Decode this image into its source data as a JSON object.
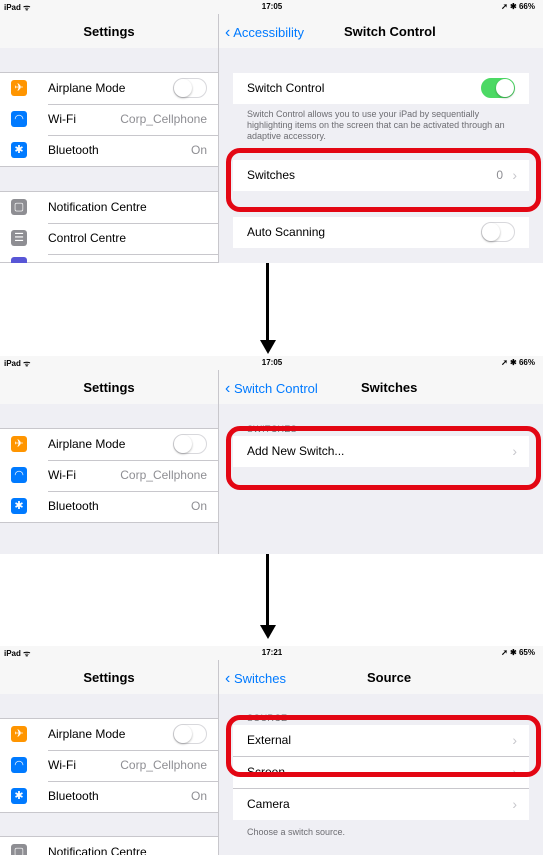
{
  "panels": [
    {
      "status": {
        "carrier": "iPad ᯤ",
        "time": "17:05",
        "battery": "➚ ✱ 66%"
      },
      "left_title": "Settings",
      "back_label": "Accessibility",
      "right_title": "Switch Control",
      "left_items": [
        {
          "label": "Airplane Mode",
          "value": "",
          "icon": "airplane-icon"
        },
        {
          "label": "Wi-Fi",
          "value": "Corp_Cellphone",
          "icon": "wifi-icon"
        },
        {
          "label": "Bluetooth",
          "value": "On",
          "icon": "bluetooth-icon"
        },
        {
          "label": "Notification Centre",
          "value": "",
          "icon": "notification-centre-icon"
        },
        {
          "label": "Control Centre",
          "value": "",
          "icon": "control-centre-icon"
        }
      ],
      "switch_control_label": "Switch Control",
      "switch_control_note": "Switch Control allows you to use your iPad by sequentially highlighting items on the screen that can be activated through an adaptive accessory.",
      "switches_label": "Switches",
      "switches_value": "0",
      "auto_scanning_label": "Auto Scanning"
    },
    {
      "status": {
        "carrier": "iPad ᯤ",
        "time": "17:05",
        "battery": "➚ ✱ 66%"
      },
      "left_title": "Settings",
      "back_label": "Switch Control",
      "right_title": "Switches",
      "left_items": [
        {
          "label": "Airplane Mode",
          "value": "",
          "icon": "airplane-icon"
        },
        {
          "label": "Wi-Fi",
          "value": "Corp_Cellphone",
          "icon": "wifi-icon"
        },
        {
          "label": "Bluetooth",
          "value": "On",
          "icon": "bluetooth-icon"
        }
      ],
      "section_header": "SWITCHES",
      "add_switch_label": "Add New Switch..."
    },
    {
      "status": {
        "carrier": "iPad ᯤ",
        "time": "17:21",
        "battery": "➚ ✱ 65%"
      },
      "left_title": "Settings",
      "back_label": "Switches",
      "right_title": "Source",
      "left_items": [
        {
          "label": "Airplane Mode",
          "value": "",
          "icon": "airplane-icon"
        },
        {
          "label": "Wi-Fi",
          "value": "Corp_Cellphone",
          "icon": "wifi-icon"
        },
        {
          "label": "Bluetooth",
          "value": "On",
          "icon": "bluetooth-icon"
        },
        {
          "label": "Notification Centre",
          "value": "",
          "icon": "notification-centre-icon"
        }
      ],
      "section_header": "SOURCE",
      "sources": [
        "External",
        "Screen",
        "Camera"
      ],
      "source_note": "Choose a switch source."
    }
  ],
  "colors": {
    "accent": "#007aff",
    "highlight": "#e30613",
    "toggle_on": "#4cd964",
    "airplane": "#ff9500",
    "wifi": "#007aff",
    "bluetooth": "#007aff",
    "gray_icon": "#8e8e93"
  }
}
